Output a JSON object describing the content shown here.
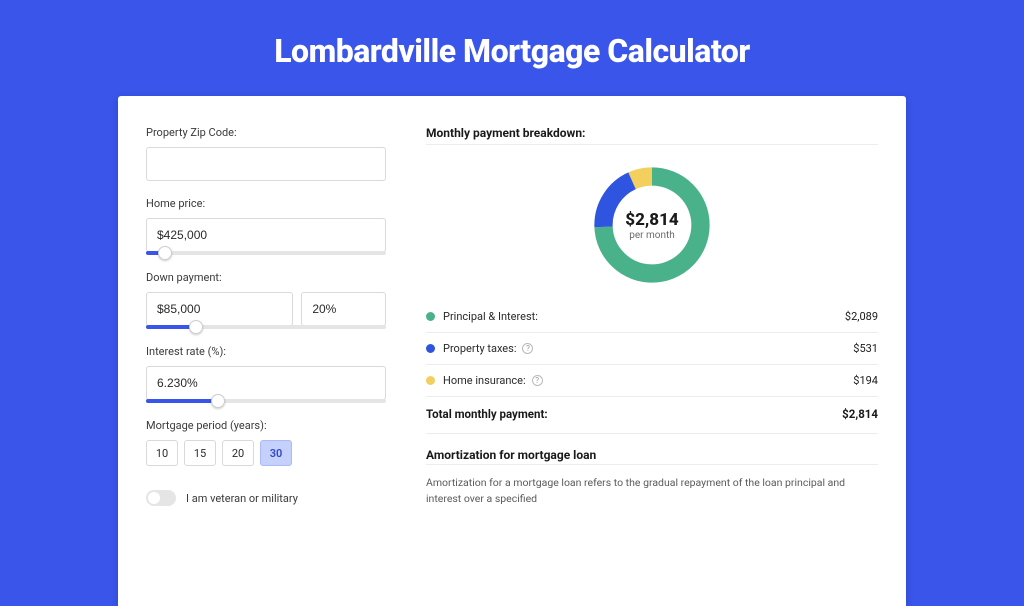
{
  "title": "Lombardville Mortgage Calculator",
  "form": {
    "zip_label": "Property Zip Code:",
    "zip_value": "",
    "home_price_label": "Home price:",
    "home_price_value": "$425,000",
    "home_price_slider_pct": 8,
    "down_payment_label": "Down payment:",
    "down_payment_value": "$85,000",
    "down_payment_pct_value": "20%",
    "down_payment_slider_pct": 21,
    "interest_label": "Interest rate (%):",
    "interest_value": "6.230%",
    "interest_slider_pct": 30,
    "period_label": "Mortgage period (years):",
    "period_options": [
      "10",
      "15",
      "20",
      "30"
    ],
    "period_selected": "30",
    "veteran_label": "I am veteran or military",
    "veteran_on": false
  },
  "breakdown": {
    "title": "Monthly payment breakdown:",
    "center_amount": "$2,814",
    "center_sub": "per month",
    "items": [
      {
        "label": "Principal & Interest:",
        "value": "$2,089",
        "color": "#49b28b",
        "info": false,
        "num": 2089
      },
      {
        "label": "Property taxes:",
        "value": "$531",
        "color": "#2f55e0",
        "info": true,
        "num": 531
      },
      {
        "label": "Home insurance:",
        "value": "$194",
        "color": "#f3cf5d",
        "info": true,
        "num": 194
      }
    ],
    "total_label": "Total monthly payment:",
    "total_value": "$2,814"
  },
  "amort": {
    "title": "Amortization for mortgage loan",
    "text": "Amortization for a mortgage loan refers to the gradual repayment of the loan principal and interest over a specified"
  },
  "chart_data": {
    "type": "pie",
    "title": "Monthly payment breakdown",
    "categories": [
      "Principal & Interest",
      "Property taxes",
      "Home insurance"
    ],
    "values": [
      2089,
      531,
      194
    ],
    "colors": [
      "#49b28b",
      "#2f55e0",
      "#f3cf5d"
    ],
    "total": 2814
  }
}
